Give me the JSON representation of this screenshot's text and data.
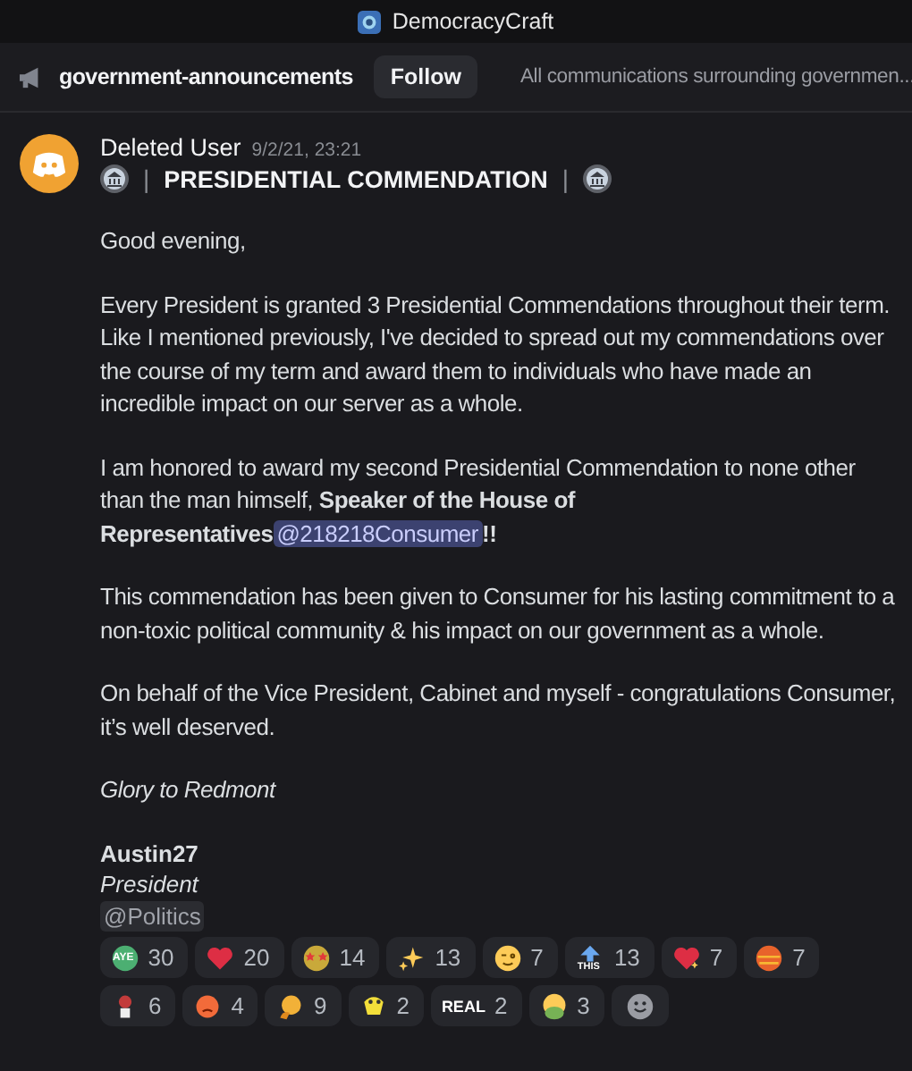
{
  "window": {
    "title": "DemocracyCraft"
  },
  "channel": {
    "name": "government-announcements",
    "follow_button": "Follow",
    "topic": "All communications surrounding governmen..."
  },
  "message": {
    "author": "Deleted User",
    "timestamp": "9/2/21, 23:21",
    "header": {
      "separator": "|",
      "title": "PRESIDENTIAL COMMENDATION"
    },
    "paragraphs": [
      [
        {
          "kind": "text",
          "text": "Good evening,"
        }
      ],
      [
        {
          "kind": "text",
          "text": "Every President is granted 3 Presidential Commendations throughout their term. Like I mentioned previously, I've decided to spread out my commendations over the course of my term and award them to individuals who have made an incredible impact on our server as a whole."
        }
      ],
      [
        {
          "kind": "text",
          "text": "I am honored to award my second Presidential Commendation to none other than the man himself, **Speaker of the House of Representatives**"
        },
        {
          "kind": "mention",
          "text": "@218218Consumer"
        },
        {
          "kind": "text",
          "text": "**!!**"
        }
      ],
      [
        {
          "kind": "text",
          "text": "This commendation has been given to Consumer for his lasting commitment to a non-toxic political community & his impact on our government as a whole."
        }
      ],
      [
        {
          "kind": "text",
          "text": "On behalf of the Vice President, Cabinet and myself - congratulations Consumer, it’s well deserved."
        }
      ],
      [
        {
          "kind": "italic",
          "text": "Glory to Redmont"
        }
      ]
    ],
    "signature": {
      "name": "Austin27",
      "role": "President",
      "mention": "@Politics"
    },
    "reactions": [
      {
        "kind": "aye",
        "emoji_label": "AYE",
        "count": "30"
      },
      {
        "kind": "heart",
        "count": "20"
      },
      {
        "kind": "starstruck",
        "count": "14"
      },
      {
        "kind": "sparkles",
        "count": "13"
      },
      {
        "kind": "wink",
        "count": "7"
      },
      {
        "kind": "this",
        "emoji_label": "THIS",
        "count": "13"
      },
      {
        "kind": "sparkleheart",
        "count": "7"
      },
      {
        "kind": "orb",
        "count": "7"
      },
      {
        "kind": "figure",
        "count": "6"
      },
      {
        "kind": "angry",
        "count": "4"
      },
      {
        "kind": "blob",
        "count": "9"
      },
      {
        "kind": "frog",
        "count": "2"
      },
      {
        "kind": "real",
        "emoji_label": "REAL",
        "count": "2"
      },
      {
        "kind": "nausea",
        "count": "3"
      }
    ]
  }
}
